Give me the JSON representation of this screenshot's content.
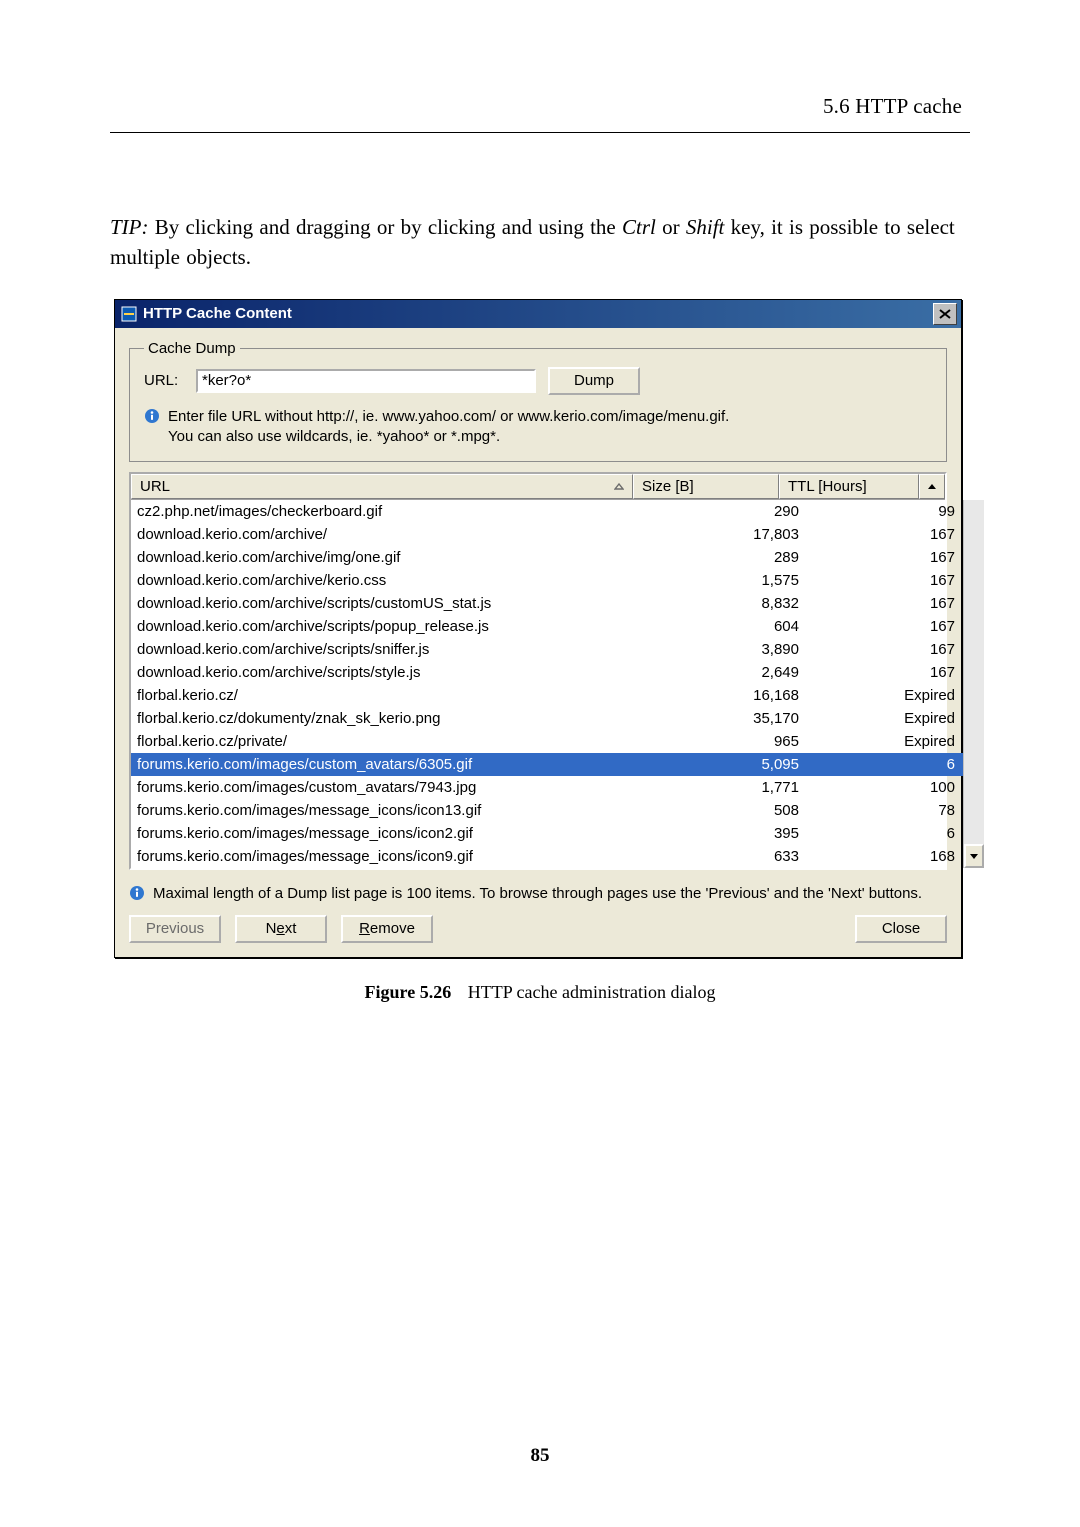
{
  "header_right": "5.6  HTTP cache",
  "tip_text_1": "TIP:",
  "tip_text_2": " By clicking and dragging or by clicking and using the ",
  "tip_ctrl": "Ctrl",
  "tip_text_3": " or ",
  "tip_shift": "Shift",
  "tip_text_4": " key, it is possible to select multiple objects.",
  "dialog": {
    "title": "HTTP Cache Content",
    "group_legend": "Cache Dump",
    "url_label": "URL:",
    "url_value": "*ker?o*",
    "dump_label": "Dump",
    "hint_line1": "Enter file URL without http://, ie. www.yahoo.com/ or www.kerio.com/image/menu.gif.",
    "hint_line2": "You can also use wildcards, ie. *yahoo* or *.mpg*.",
    "columns": {
      "url": "URL",
      "size": "Size [B]",
      "ttl": "TTL [Hours]"
    },
    "rows": [
      {
        "url": "cz2.php.net/images/checkerboard.gif",
        "size": "290",
        "ttl": "99",
        "selected": false
      },
      {
        "url": "download.kerio.com/archive/",
        "size": "17,803",
        "ttl": "167",
        "selected": false
      },
      {
        "url": "download.kerio.com/archive/img/one.gif",
        "size": "289",
        "ttl": "167",
        "selected": false
      },
      {
        "url": "download.kerio.com/archive/kerio.css",
        "size": "1,575",
        "ttl": "167",
        "selected": false
      },
      {
        "url": "download.kerio.com/archive/scripts/customUS_stat.js",
        "size": "8,832",
        "ttl": "167",
        "selected": false
      },
      {
        "url": "download.kerio.com/archive/scripts/popup_release.js",
        "size": "604",
        "ttl": "167",
        "selected": false
      },
      {
        "url": "download.kerio.com/archive/scripts/sniffer.js",
        "size": "3,890",
        "ttl": "167",
        "selected": false
      },
      {
        "url": "download.kerio.com/archive/scripts/style.js",
        "size": "2,649",
        "ttl": "167",
        "selected": false
      },
      {
        "url": "florbal.kerio.cz/",
        "size": "16,168",
        "ttl": "Expired",
        "selected": false
      },
      {
        "url": "florbal.kerio.cz/dokumenty/znak_sk_kerio.png",
        "size": "35,170",
        "ttl": "Expired",
        "selected": false
      },
      {
        "url": "florbal.kerio.cz/private/",
        "size": "965",
        "ttl": "Expired",
        "selected": false
      },
      {
        "url": "forums.kerio.com/images/custom_avatars/6305.gif",
        "size": "5,095",
        "ttl": "6",
        "selected": true
      },
      {
        "url": "forums.kerio.com/images/custom_avatars/7943.jpg",
        "size": "1,771",
        "ttl": "100",
        "selected": false
      },
      {
        "url": "forums.kerio.com/images/message_icons/icon13.gif",
        "size": "508",
        "ttl": "78",
        "selected": false
      },
      {
        "url": "forums.kerio.com/images/message_icons/icon2.gif",
        "size": "395",
        "ttl": "6",
        "selected": false
      },
      {
        "url": "forums.kerio.com/images/message_icons/icon9.gif",
        "size": "633",
        "ttl": "168",
        "selected": false
      }
    ],
    "footer_hint": "Maximal length of a Dump list page is 100 items. To browse through pages use the 'Previous' and the 'Next' buttons.",
    "btn_prev": "Previous",
    "btn_next_pre": "N",
    "btn_next_u": "e",
    "btn_next_post": "xt",
    "btn_remove_u": "R",
    "btn_remove_post": "emove",
    "btn_close": "Close"
  },
  "caption_lead": "Figure 5.26",
  "caption_rest": "HTTP cache administration dialog",
  "page_number": "85"
}
